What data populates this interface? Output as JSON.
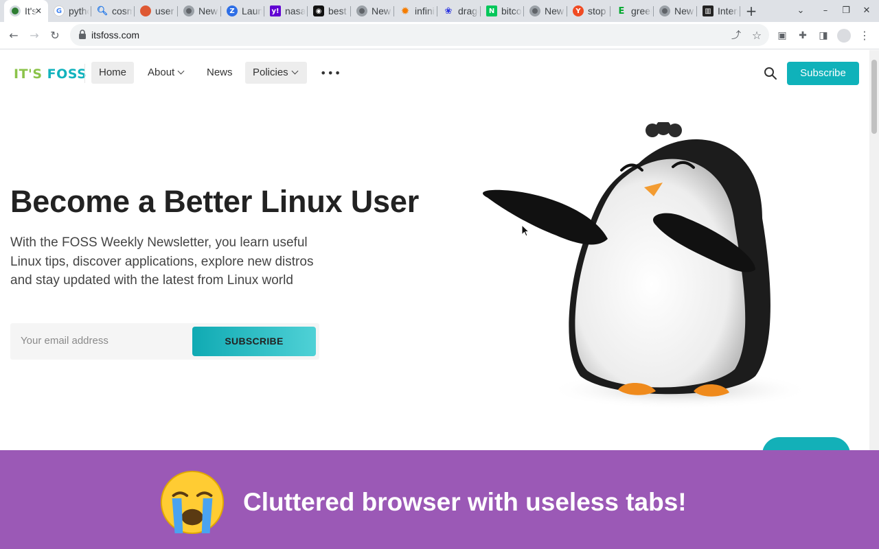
{
  "browser": {
    "tabs": [
      {
        "title": "It's FOSS",
        "favicon": "itsfoss-icon",
        "active": true
      },
      {
        "title": "python",
        "favicon": "google-icon"
      },
      {
        "title": "cosmos",
        "favicon": "search-icon"
      },
      {
        "title": "user",
        "favicon": "duckduckgo-icon"
      },
      {
        "title": "New Tab",
        "favicon": "chrome-icon"
      },
      {
        "title": "Launch",
        "favicon": "z-icon"
      },
      {
        "title": "nasa",
        "favicon": "yahoo-icon"
      },
      {
        "title": "best",
        "favicon": "alien-icon"
      },
      {
        "title": "New Tab",
        "favicon": "chrome-icon"
      },
      {
        "title": "infinity",
        "favicon": "sun-icon"
      },
      {
        "title": "dragon",
        "favicon": "paw-icon"
      },
      {
        "title": "bitcoin",
        "favicon": "n-icon"
      },
      {
        "title": "New Tab",
        "favicon": "chrome-icon"
      },
      {
        "title": "stop",
        "favicon": "y-icon"
      },
      {
        "title": "green",
        "favicon": "e-icon"
      },
      {
        "title": "New Tab",
        "favicon": "chrome-icon"
      },
      {
        "title": "Internet",
        "favicon": "archive-icon"
      }
    ],
    "url": "itsfoss.com"
  },
  "site": {
    "logo_a": "IT'S",
    "logo_b": "FOSS",
    "nav": {
      "home": "Home",
      "about": "About",
      "news": "News",
      "policies": "Policies",
      "more": "•••"
    },
    "subscribe_top": "Subscribe"
  },
  "hero": {
    "title": "Become a Better Linux User",
    "subtitle": "With the FOSS Weekly Newsletter, you learn useful Linux tips, discover applications, explore new distros and stay updated with the latest from Linux world",
    "email_placeholder": "Your email address",
    "subscribe_button": "SUBSCRIBE"
  },
  "banner": {
    "text": "Cluttered browser with useless tabs!"
  },
  "colors": {
    "accent": "#0fb2ba",
    "logo_green": "#8bc34a",
    "banner": "#9b59b6"
  }
}
